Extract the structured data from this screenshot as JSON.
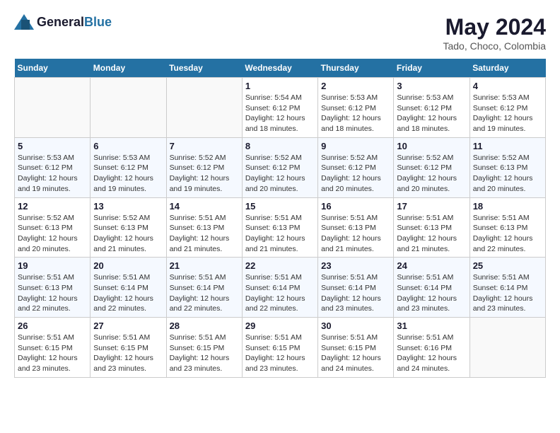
{
  "header": {
    "logo_general": "General",
    "logo_blue": "Blue",
    "month_year": "May 2024",
    "location": "Tado, Choco, Colombia"
  },
  "weekdays": [
    "Sunday",
    "Monday",
    "Tuesday",
    "Wednesday",
    "Thursday",
    "Friday",
    "Saturday"
  ],
  "weeks": [
    [
      {
        "day": "",
        "info": ""
      },
      {
        "day": "",
        "info": ""
      },
      {
        "day": "",
        "info": ""
      },
      {
        "day": "1",
        "info": "Sunrise: 5:54 AM\nSunset: 6:12 PM\nDaylight: 12 hours and 18 minutes."
      },
      {
        "day": "2",
        "info": "Sunrise: 5:53 AM\nSunset: 6:12 PM\nDaylight: 12 hours and 18 minutes."
      },
      {
        "day": "3",
        "info": "Sunrise: 5:53 AM\nSunset: 6:12 PM\nDaylight: 12 hours and 18 minutes."
      },
      {
        "day": "4",
        "info": "Sunrise: 5:53 AM\nSunset: 6:12 PM\nDaylight: 12 hours and 19 minutes."
      }
    ],
    [
      {
        "day": "5",
        "info": "Sunrise: 5:53 AM\nSunset: 6:12 PM\nDaylight: 12 hours and 19 minutes."
      },
      {
        "day": "6",
        "info": "Sunrise: 5:53 AM\nSunset: 6:12 PM\nDaylight: 12 hours and 19 minutes."
      },
      {
        "day": "7",
        "info": "Sunrise: 5:52 AM\nSunset: 6:12 PM\nDaylight: 12 hours and 19 minutes."
      },
      {
        "day": "8",
        "info": "Sunrise: 5:52 AM\nSunset: 6:12 PM\nDaylight: 12 hours and 20 minutes."
      },
      {
        "day": "9",
        "info": "Sunrise: 5:52 AM\nSunset: 6:12 PM\nDaylight: 12 hours and 20 minutes."
      },
      {
        "day": "10",
        "info": "Sunrise: 5:52 AM\nSunset: 6:12 PM\nDaylight: 12 hours and 20 minutes."
      },
      {
        "day": "11",
        "info": "Sunrise: 5:52 AM\nSunset: 6:13 PM\nDaylight: 12 hours and 20 minutes."
      }
    ],
    [
      {
        "day": "12",
        "info": "Sunrise: 5:52 AM\nSunset: 6:13 PM\nDaylight: 12 hours and 20 minutes."
      },
      {
        "day": "13",
        "info": "Sunrise: 5:52 AM\nSunset: 6:13 PM\nDaylight: 12 hours and 21 minutes."
      },
      {
        "day": "14",
        "info": "Sunrise: 5:51 AM\nSunset: 6:13 PM\nDaylight: 12 hours and 21 minutes."
      },
      {
        "day": "15",
        "info": "Sunrise: 5:51 AM\nSunset: 6:13 PM\nDaylight: 12 hours and 21 minutes."
      },
      {
        "day": "16",
        "info": "Sunrise: 5:51 AM\nSunset: 6:13 PM\nDaylight: 12 hours and 21 minutes."
      },
      {
        "day": "17",
        "info": "Sunrise: 5:51 AM\nSunset: 6:13 PM\nDaylight: 12 hours and 21 minutes."
      },
      {
        "day": "18",
        "info": "Sunrise: 5:51 AM\nSunset: 6:13 PM\nDaylight: 12 hours and 22 minutes."
      }
    ],
    [
      {
        "day": "19",
        "info": "Sunrise: 5:51 AM\nSunset: 6:13 PM\nDaylight: 12 hours and 22 minutes."
      },
      {
        "day": "20",
        "info": "Sunrise: 5:51 AM\nSunset: 6:14 PM\nDaylight: 12 hours and 22 minutes."
      },
      {
        "day": "21",
        "info": "Sunrise: 5:51 AM\nSunset: 6:14 PM\nDaylight: 12 hours and 22 minutes."
      },
      {
        "day": "22",
        "info": "Sunrise: 5:51 AM\nSunset: 6:14 PM\nDaylight: 12 hours and 22 minutes."
      },
      {
        "day": "23",
        "info": "Sunrise: 5:51 AM\nSunset: 6:14 PM\nDaylight: 12 hours and 23 minutes."
      },
      {
        "day": "24",
        "info": "Sunrise: 5:51 AM\nSunset: 6:14 PM\nDaylight: 12 hours and 23 minutes."
      },
      {
        "day": "25",
        "info": "Sunrise: 5:51 AM\nSunset: 6:14 PM\nDaylight: 12 hours and 23 minutes."
      }
    ],
    [
      {
        "day": "26",
        "info": "Sunrise: 5:51 AM\nSunset: 6:15 PM\nDaylight: 12 hours and 23 minutes."
      },
      {
        "day": "27",
        "info": "Sunrise: 5:51 AM\nSunset: 6:15 PM\nDaylight: 12 hours and 23 minutes."
      },
      {
        "day": "28",
        "info": "Sunrise: 5:51 AM\nSunset: 6:15 PM\nDaylight: 12 hours and 23 minutes."
      },
      {
        "day": "29",
        "info": "Sunrise: 5:51 AM\nSunset: 6:15 PM\nDaylight: 12 hours and 23 minutes."
      },
      {
        "day": "30",
        "info": "Sunrise: 5:51 AM\nSunset: 6:15 PM\nDaylight: 12 hours and 24 minutes."
      },
      {
        "day": "31",
        "info": "Sunrise: 5:51 AM\nSunset: 6:16 PM\nDaylight: 12 hours and 24 minutes."
      },
      {
        "day": "",
        "info": ""
      }
    ]
  ]
}
